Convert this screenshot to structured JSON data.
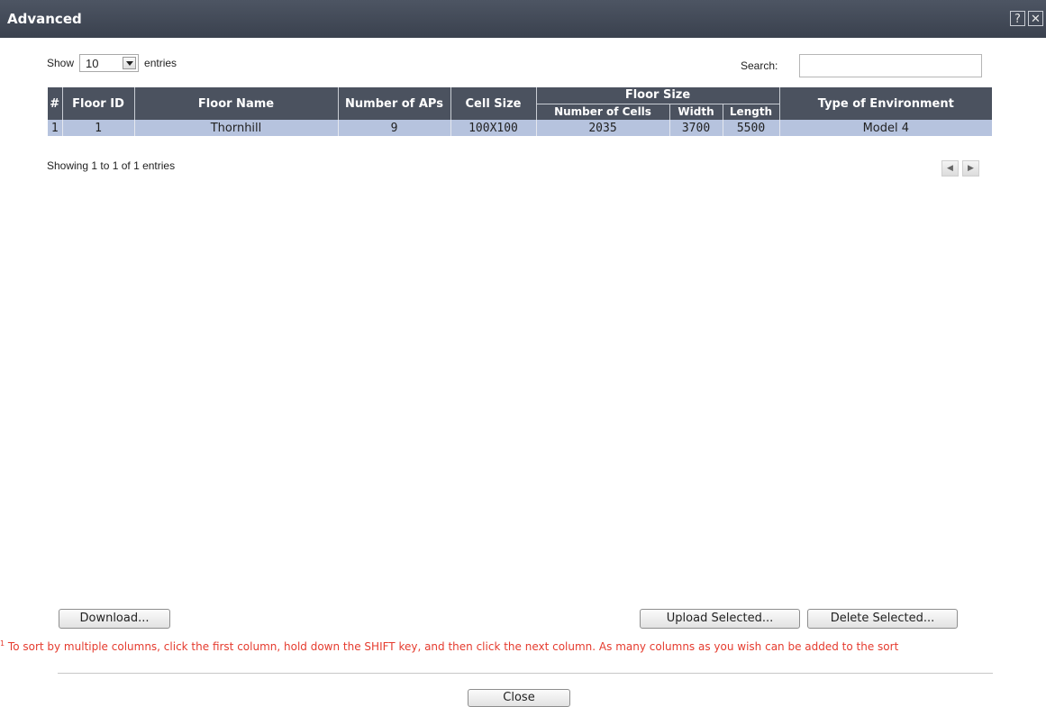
{
  "dialog": {
    "title": "Advanced",
    "help_label": "?",
    "close_label": "✕"
  },
  "length_menu": {
    "prefix": "Show",
    "selected": "10",
    "suffix": "entries"
  },
  "search": {
    "label": "Search:",
    "value": ""
  },
  "table": {
    "headers": {
      "sort_marker": "#",
      "floor_id": "Floor ID",
      "floor_name": "Floor Name",
      "num_aps": "Number of APs",
      "cell_size": "Cell Size",
      "floor_size": "Floor Size",
      "num_cells": "Number of Cells",
      "width": "Width",
      "length": "Length",
      "environment": "Type of Environment"
    },
    "rows": [
      {
        "index": "1",
        "floor_id": "1",
        "floor_name": "Thornhill",
        "num_aps": "9",
        "cell_size": "100X100",
        "num_cells": "2035",
        "width": "3700",
        "length": "5500",
        "environment": "Model 4"
      }
    ]
  },
  "info_text": "Showing 1 to 1 of 1 entries",
  "pager": {
    "prev_icon": "arrow-left-icon",
    "next_icon": "arrow-right-icon"
  },
  "buttons": {
    "download": "Download...",
    "upload": "Upload Selected...",
    "delete": "Delete Selected...",
    "close": "Close"
  },
  "footnote": {
    "marker": "1",
    "text": " To sort by multiple columns, click the first column, hold down the SHIFT key, and then click the next column. As many columns as you wish can be added to the sort"
  },
  "colors": {
    "titlebar": "#3f4653",
    "header": "#4b525f",
    "selected_row": "#b6c3de",
    "footnote": "#e53b2e"
  }
}
